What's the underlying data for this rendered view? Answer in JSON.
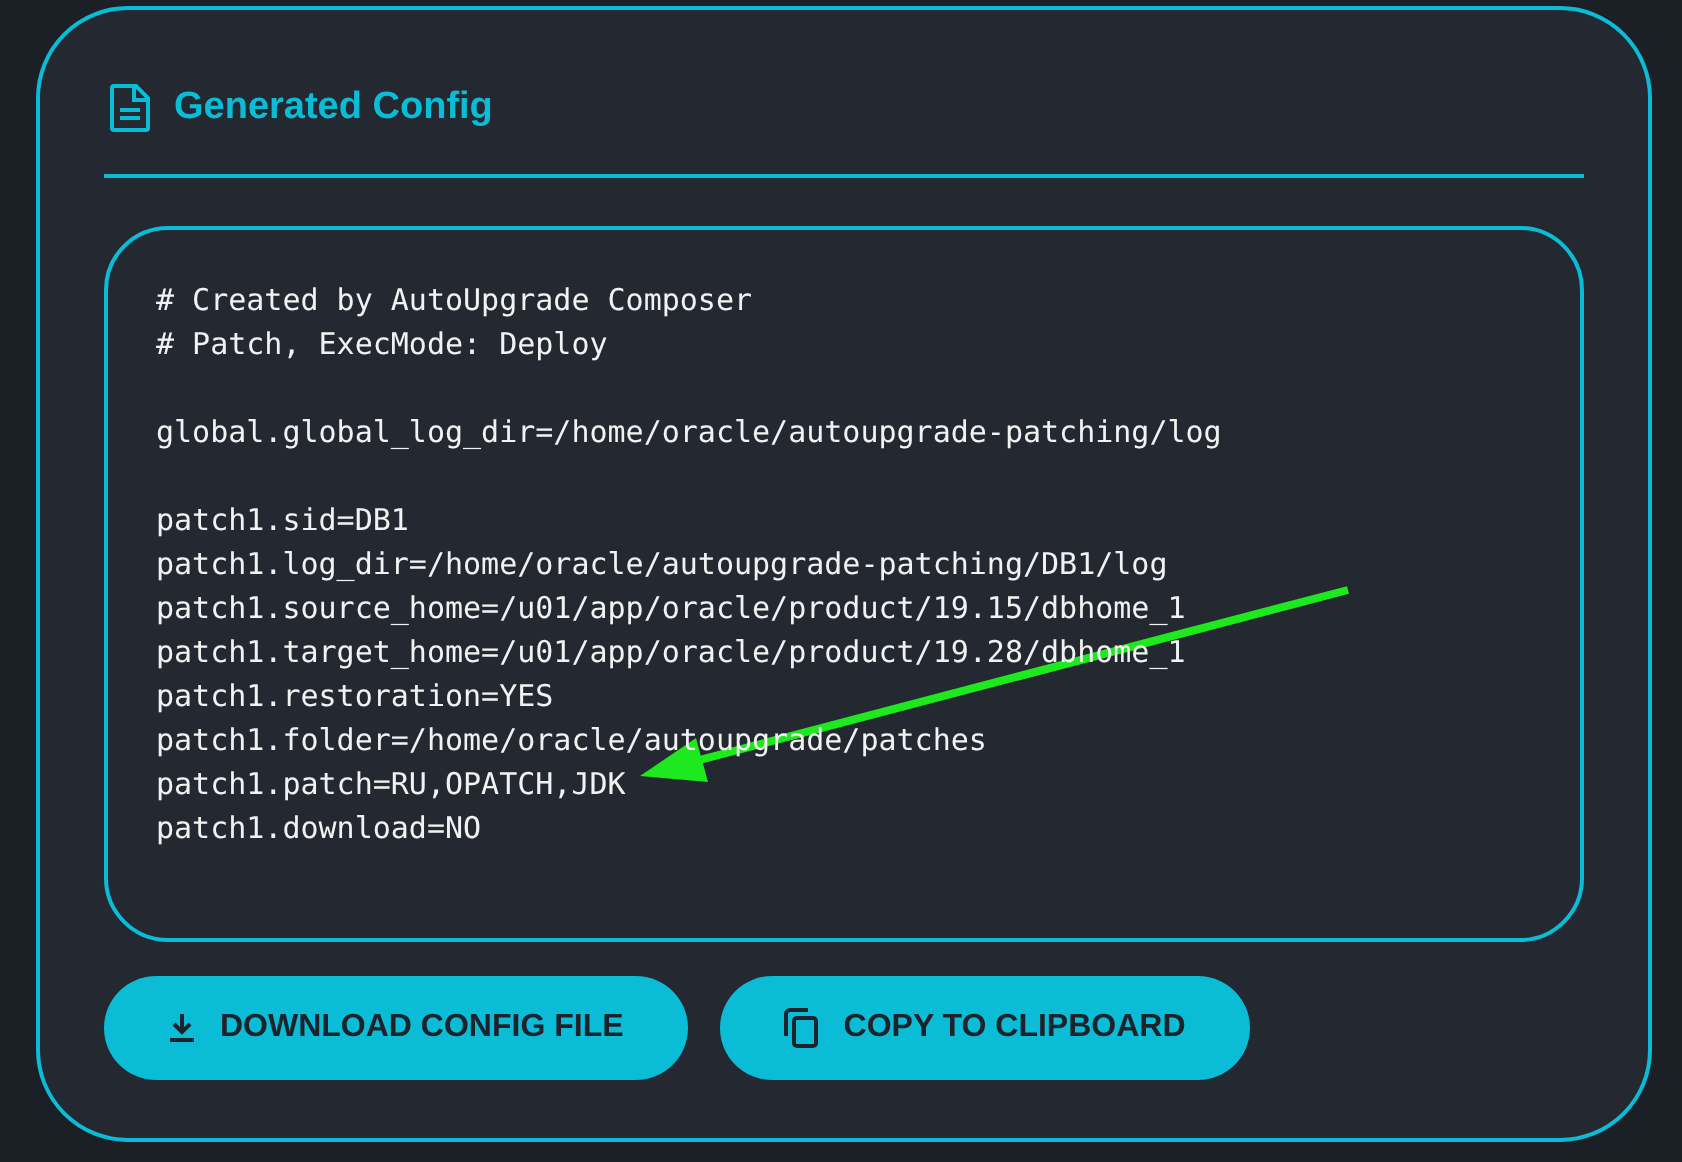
{
  "panel": {
    "title": "Generated Config",
    "config_blocks": [
      [
        "# Created by AutoUpgrade Composer",
        "# Patch, ExecMode: Deploy"
      ],
      [
        "global.global_log_dir=/home/oracle/autoupgrade-patching/log"
      ],
      [
        "patch1.sid=DB1",
        "patch1.log_dir=/home/oracle/autoupgrade-patching/DB1/log",
        "patch1.source_home=/u01/app/oracle/product/19.15/dbhome_1",
        "patch1.target_home=/u01/app/oracle/product/19.28/dbhome_1",
        "patch1.restoration=YES",
        "patch1.folder=/home/oracle/autoupgrade/patches",
        "patch1.patch=RU,OPATCH,JDK",
        "patch1.download=NO"
      ]
    ],
    "buttons": [
      {
        "kind": "download",
        "label": "DOWNLOAD CONFIG FILE"
      },
      {
        "kind": "copy",
        "label": "COPY TO CLIPBOARD"
      }
    ]
  }
}
